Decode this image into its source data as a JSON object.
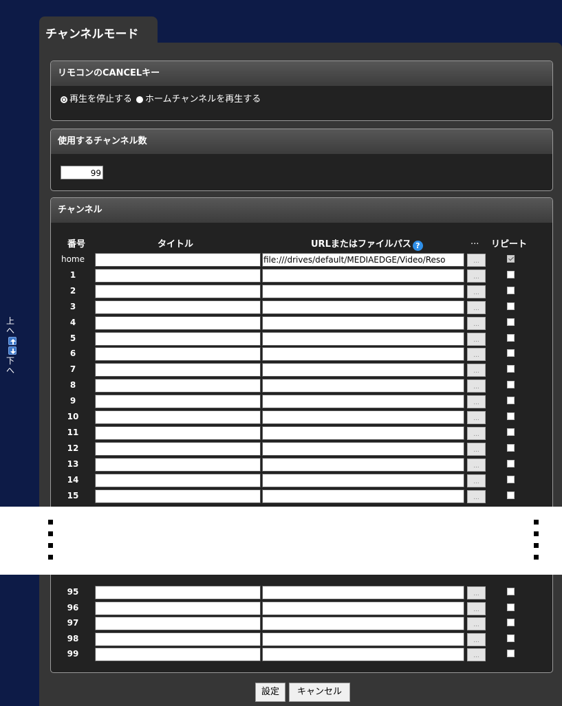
{
  "page": {
    "tab_title": "チャンネルモード"
  },
  "side_nav": {
    "up_label": "上へ",
    "down_label": "下へ"
  },
  "cancel_key": {
    "heading": "リモコンのCANCELキー",
    "options": [
      {
        "label": "再生を停止する",
        "selected": false
      },
      {
        "label": "ホームチャンネルを再生する",
        "selected": true
      }
    ]
  },
  "channel_count": {
    "heading": "使用するチャンネル数",
    "value": "99"
  },
  "channels": {
    "heading": "チャンネル",
    "columns": {
      "number": "番号",
      "title": "タイトル",
      "url": "URLまたはファイルパス",
      "browse": "...",
      "repeat": "リピート"
    },
    "help_icon_text": "?",
    "browse_label": "...",
    "rows_top": [
      {
        "num": "home",
        "title": "",
        "url": "file:///drives/default/MEDIAEDGE/Video/Reso",
        "repeat": true
      },
      {
        "num": "1",
        "title": "",
        "url": "",
        "repeat": false
      },
      {
        "num": "2",
        "title": "",
        "url": "",
        "repeat": false
      },
      {
        "num": "3",
        "title": "",
        "url": "",
        "repeat": false
      },
      {
        "num": "4",
        "title": "",
        "url": "",
        "repeat": false
      },
      {
        "num": "5",
        "title": "",
        "url": "",
        "repeat": false
      },
      {
        "num": "6",
        "title": "",
        "url": "",
        "repeat": false
      },
      {
        "num": "7",
        "title": "",
        "url": "",
        "repeat": false
      },
      {
        "num": "8",
        "title": "",
        "url": "",
        "repeat": false
      },
      {
        "num": "9",
        "title": "",
        "url": "",
        "repeat": false
      },
      {
        "num": "10",
        "title": "",
        "url": "",
        "repeat": false
      },
      {
        "num": "11",
        "title": "",
        "url": "",
        "repeat": false
      },
      {
        "num": "12",
        "title": "",
        "url": "",
        "repeat": false
      },
      {
        "num": "13",
        "title": "",
        "url": "",
        "repeat": false
      },
      {
        "num": "14",
        "title": "",
        "url": "",
        "repeat": false
      },
      {
        "num": "15",
        "title": "",
        "url": "",
        "repeat": false
      }
    ],
    "rows_bottom": [
      {
        "num": "95",
        "title": "",
        "url": "",
        "repeat": false
      },
      {
        "num": "96",
        "title": "",
        "url": "",
        "repeat": false
      },
      {
        "num": "97",
        "title": "",
        "url": "",
        "repeat": false
      },
      {
        "num": "98",
        "title": "",
        "url": "",
        "repeat": false
      },
      {
        "num": "99",
        "title": "",
        "url": "",
        "repeat": false
      }
    ]
  },
  "buttons": {
    "save": "設定",
    "cancel": "キャンセル"
  },
  "colors": {
    "background": "#0d1b47",
    "panel": "#363636",
    "section": "#222222",
    "help": "#2f8fe8",
    "nav_arrow": "#3f78c8"
  }
}
